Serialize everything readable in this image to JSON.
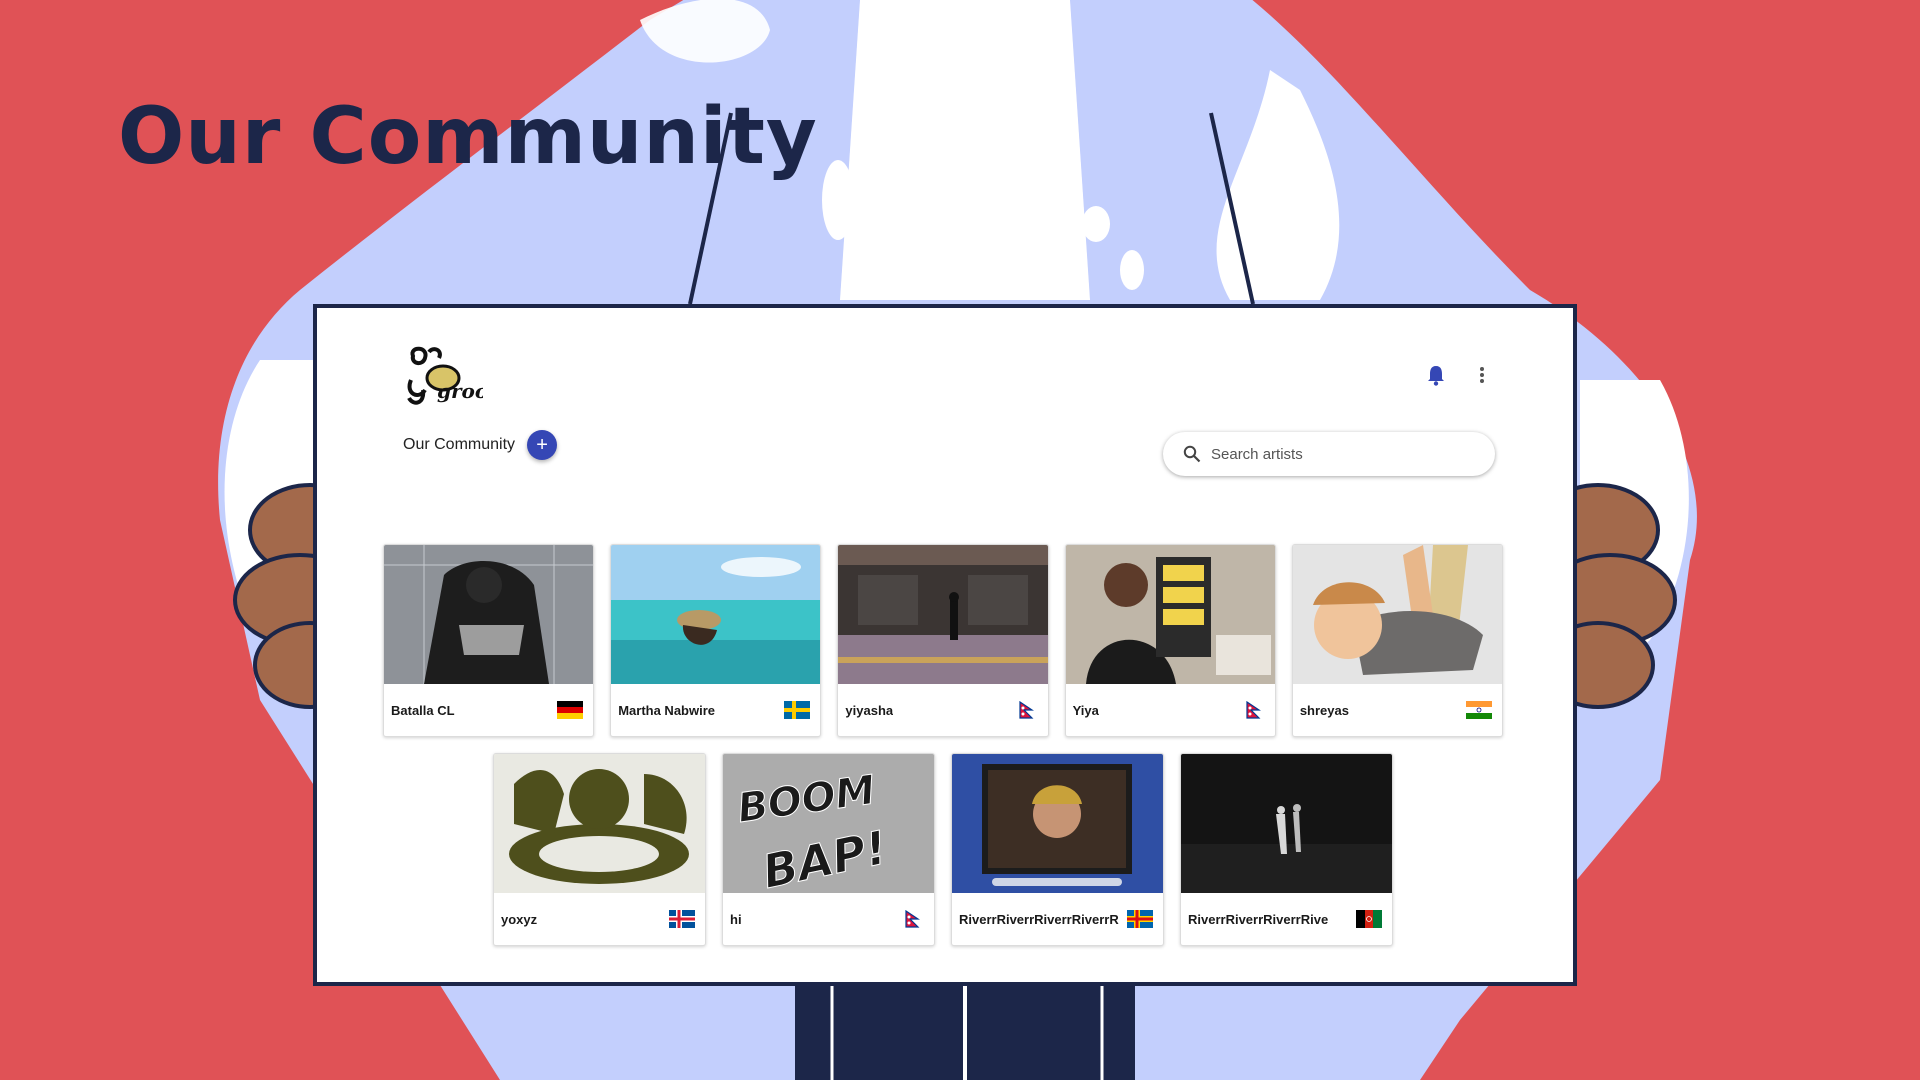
{
  "slide": {
    "title": "Our Community"
  },
  "colors": {
    "background": "#e05256",
    "navy": "#1c2649",
    "blob": "#c3cffd",
    "skin": "#a3694b",
    "accent": "#3547b5"
  },
  "app": {
    "logo_text": "groove",
    "header_icons": [
      "bell-icon",
      "more-vert-icon"
    ],
    "section_title": "Our Community",
    "add_button_label": "+",
    "search": {
      "placeholder": "Search artists",
      "value": ""
    }
  },
  "artists": [
    {
      "name": "Batalla CL",
      "flag": "germany",
      "thumb": "street-dancer-photo"
    },
    {
      "name": "Martha Nabwire",
      "flag": "sweden",
      "thumb": "woman-in-sea-photo"
    },
    {
      "name": "yiyasha",
      "flag": "nepal",
      "thumb": "dancer-in-hall-photo"
    },
    {
      "name": "Yiya",
      "flag": "nepal",
      "thumb": "person-holding-book-photo"
    },
    {
      "name": "shreyas",
      "flag": "india",
      "thumb": "cartoon-breakdancer"
    },
    {
      "name": "yoxyz",
      "flag": "iceland",
      "thumb": "dj-illustration"
    },
    {
      "name": "hi",
      "flag": "nepal",
      "thumb": "boom-bap-graffiti"
    },
    {
      "name": "RiverrRiverrRiverrRiverrR",
      "flag": "aland",
      "thumb": "webcam-screenshot"
    },
    {
      "name": "RiverrRiverrRiverrRive",
      "flag": "afghanistan",
      "thumb": "night-dancers-photo"
    }
  ]
}
